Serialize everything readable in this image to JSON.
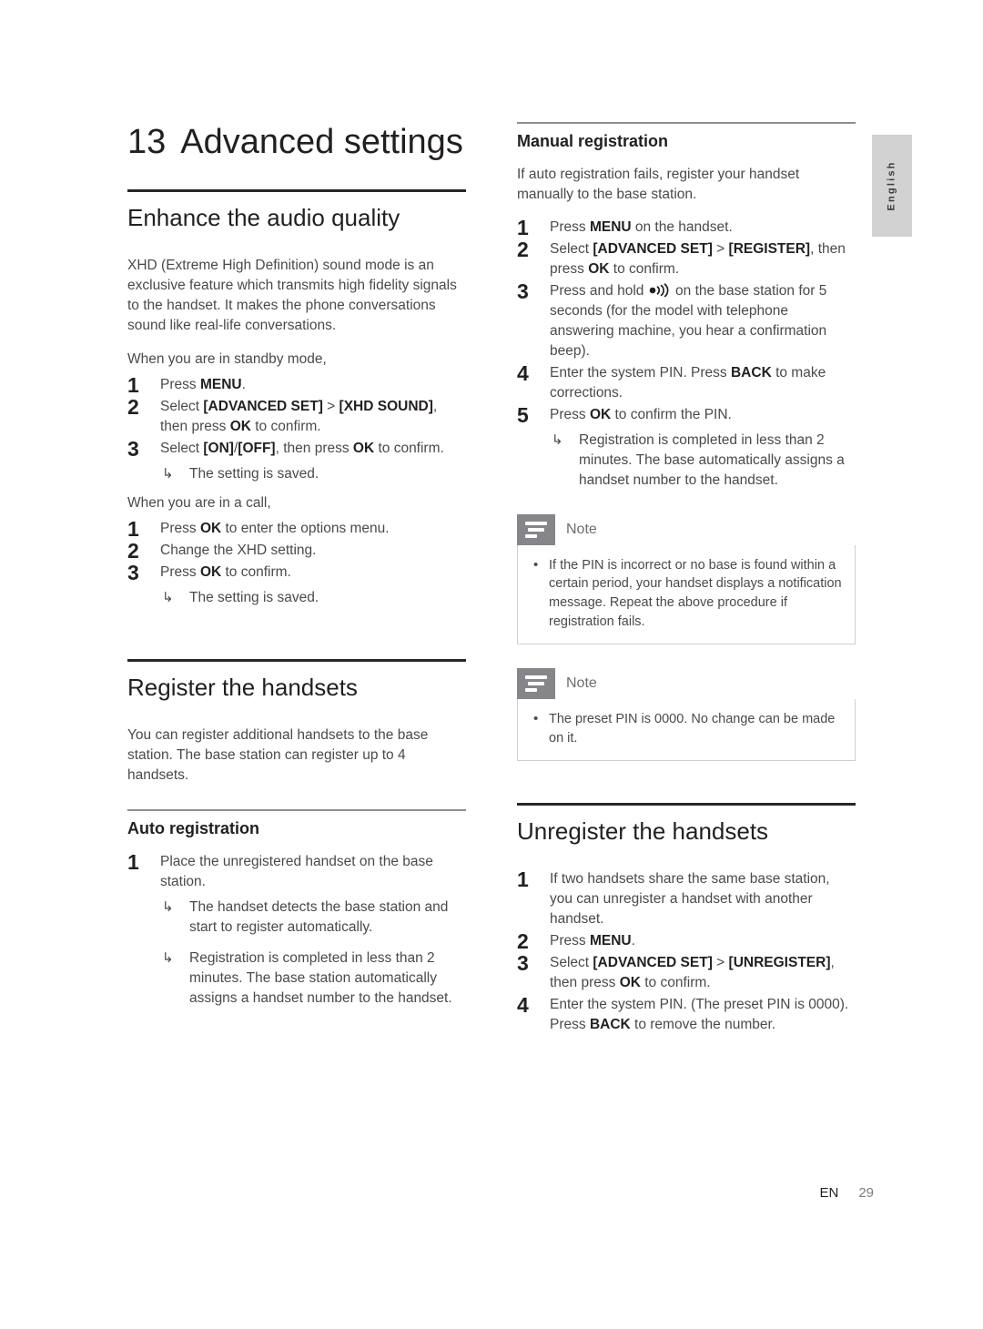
{
  "side_tab": {
    "language": "English"
  },
  "footer": {
    "locale": "EN",
    "page_number": "29"
  },
  "chapter": {
    "number": "13",
    "title": "Advanced settings"
  },
  "left_column": {
    "audio": {
      "heading": "Enhance the audio quality",
      "intro": "XHD (Extreme High Definition) sound mode is an exclusive feature which transmits high fidelity signals to the handset. It makes the phone conversations sound like real-life conversations.",
      "standby_lead": "When you are in standby mode,",
      "standby_steps": [
        {
          "num": "1",
          "parts": [
            {
              "t": "Press ",
              "b": false
            },
            {
              "t": "MENU",
              "b": true
            },
            {
              "t": ".",
              "b": false
            }
          ]
        },
        {
          "num": "2",
          "parts": [
            {
              "t": "Select ",
              "b": false
            },
            {
              "t": "[ADVANCED SET]",
              "b": true
            },
            {
              "t": " > ",
              "b": false
            },
            {
              "t": "[XHD SOUND]",
              "b": true
            },
            {
              "t": ", then press ",
              "b": false
            },
            {
              "t": "OK",
              "b": true
            },
            {
              "t": " to confirm.",
              "b": false
            }
          ]
        },
        {
          "num": "3",
          "parts": [
            {
              "t": "Select ",
              "b": false
            },
            {
              "t": "[ON]",
              "b": true
            },
            {
              "t": "/",
              "b": false
            },
            {
              "t": "[OFF]",
              "b": true
            },
            {
              "t": ", then press ",
              "b": false
            },
            {
              "t": "OK",
              "b": true
            },
            {
              "t": " to confirm.",
              "b": false
            }
          ],
          "results": [
            "The setting is saved."
          ]
        }
      ],
      "incall_lead": "When you are in a call,",
      "incall_steps": [
        {
          "num": "1",
          "parts": [
            {
              "t": "Press ",
              "b": false
            },
            {
              "t": "OK",
              "b": true
            },
            {
              "t": " to enter the options menu.",
              "b": false
            }
          ]
        },
        {
          "num": "2",
          "parts": [
            {
              "t": "Change the XHD setting.",
              "b": false
            }
          ]
        },
        {
          "num": "3",
          "parts": [
            {
              "t": "Press ",
              "b": false
            },
            {
              "t": "OK",
              "b": true
            },
            {
              "t": " to confirm.",
              "b": false
            }
          ],
          "results": [
            "The setting is saved."
          ]
        }
      ]
    },
    "register": {
      "heading": "Register the handsets",
      "intro": "You can register additional handsets to the base station. The base station can register up to 4 handsets.",
      "auto": {
        "heading": "Auto registration",
        "steps": [
          {
            "num": "1",
            "parts": [
              {
                "t": "Place the unregistered handset on the base station.",
                "b": false
              }
            ],
            "results": [
              "The handset detects the base station and start to register automatically.",
              "Registration is completed in less than 2 minutes. The base station automatically assigns a handset number to the handset."
            ]
          }
        ]
      }
    }
  },
  "right_column": {
    "manual": {
      "heading": "Manual registration",
      "intro": "If auto registration fails, register your handset manually to the base station.",
      "steps": [
        {
          "num": "1",
          "parts": [
            {
              "t": "Press ",
              "b": false
            },
            {
              "t": "MENU",
              "b": true
            },
            {
              "t": " on the handset.",
              "b": false
            }
          ]
        },
        {
          "num": "2",
          "parts": [
            {
              "t": "Select ",
              "b": false
            },
            {
              "t": "[ADVANCED SET]",
              "b": true
            },
            {
              "t": " > ",
              "b": false
            },
            {
              "t": "[REGISTER]",
              "b": true
            },
            {
              "t": ", then press ",
              "b": false
            },
            {
              "t": "OK",
              "b": true
            },
            {
              "t": " to confirm.",
              "b": false
            }
          ]
        },
        {
          "num": "3",
          "parts": [
            {
              "t": "Press and hold ",
              "b": false
            },
            {
              "t": "__PAGING_ICON__",
              "b": false
            },
            {
              "t": " on the base station for 5 seconds (for the model with telephone answering machine, you hear a confirmation beep).",
              "b": false
            }
          ]
        },
        {
          "num": "4",
          "parts": [
            {
              "t": "Enter the system PIN. Press ",
              "b": false
            },
            {
              "t": "BACK",
              "b": true
            },
            {
              "t": " to make corrections.",
              "b": false
            }
          ]
        },
        {
          "num": "5",
          "parts": [
            {
              "t": "Press ",
              "b": false
            },
            {
              "t": "OK",
              "b": true
            },
            {
              "t": " to confirm the PIN.",
              "b": false
            }
          ],
          "results": [
            "Registration is completed in less than 2 minutes. The base automatically assigns a handset number to the handset."
          ]
        }
      ]
    },
    "notes": [
      {
        "label": "Note",
        "items": [
          "If the PIN is incorrect or no base is found within a certain period, your handset displays a notification message. Repeat the above procedure if registration fails."
        ]
      },
      {
        "label": "Note",
        "items": [
          "The preset PIN is 0000. No change can be made on it."
        ]
      }
    ],
    "unregister": {
      "heading": "Unregister the handsets",
      "steps": [
        {
          "num": "1",
          "parts": [
            {
              "t": "If two handsets share the same base station, you can unregister a handset with another handset.",
              "b": false
            }
          ]
        },
        {
          "num": "2",
          "parts": [
            {
              "t": "Press ",
              "b": false
            },
            {
              "t": "MENU",
              "b": true
            },
            {
              "t": ".",
              "b": false
            }
          ]
        },
        {
          "num": "3",
          "parts": [
            {
              "t": "Select ",
              "b": false
            },
            {
              "t": "[ADVANCED SET]",
              "b": true
            },
            {
              "t": " > ",
              "b": false
            },
            {
              "t": "[UNREGISTER]",
              "b": true
            },
            {
              "t": ", then press ",
              "b": false
            },
            {
              "t": "OK",
              "b": true
            },
            {
              "t": " to confirm.",
              "b": false
            }
          ]
        },
        {
          "num": "4",
          "parts": [
            {
              "t": "Enter the system PIN. (The preset PIN is 0000). Press ",
              "b": false
            },
            {
              "t": "BACK",
              "b": true
            },
            {
              "t": " to remove the number.",
              "b": false
            }
          ]
        }
      ]
    }
  }
}
